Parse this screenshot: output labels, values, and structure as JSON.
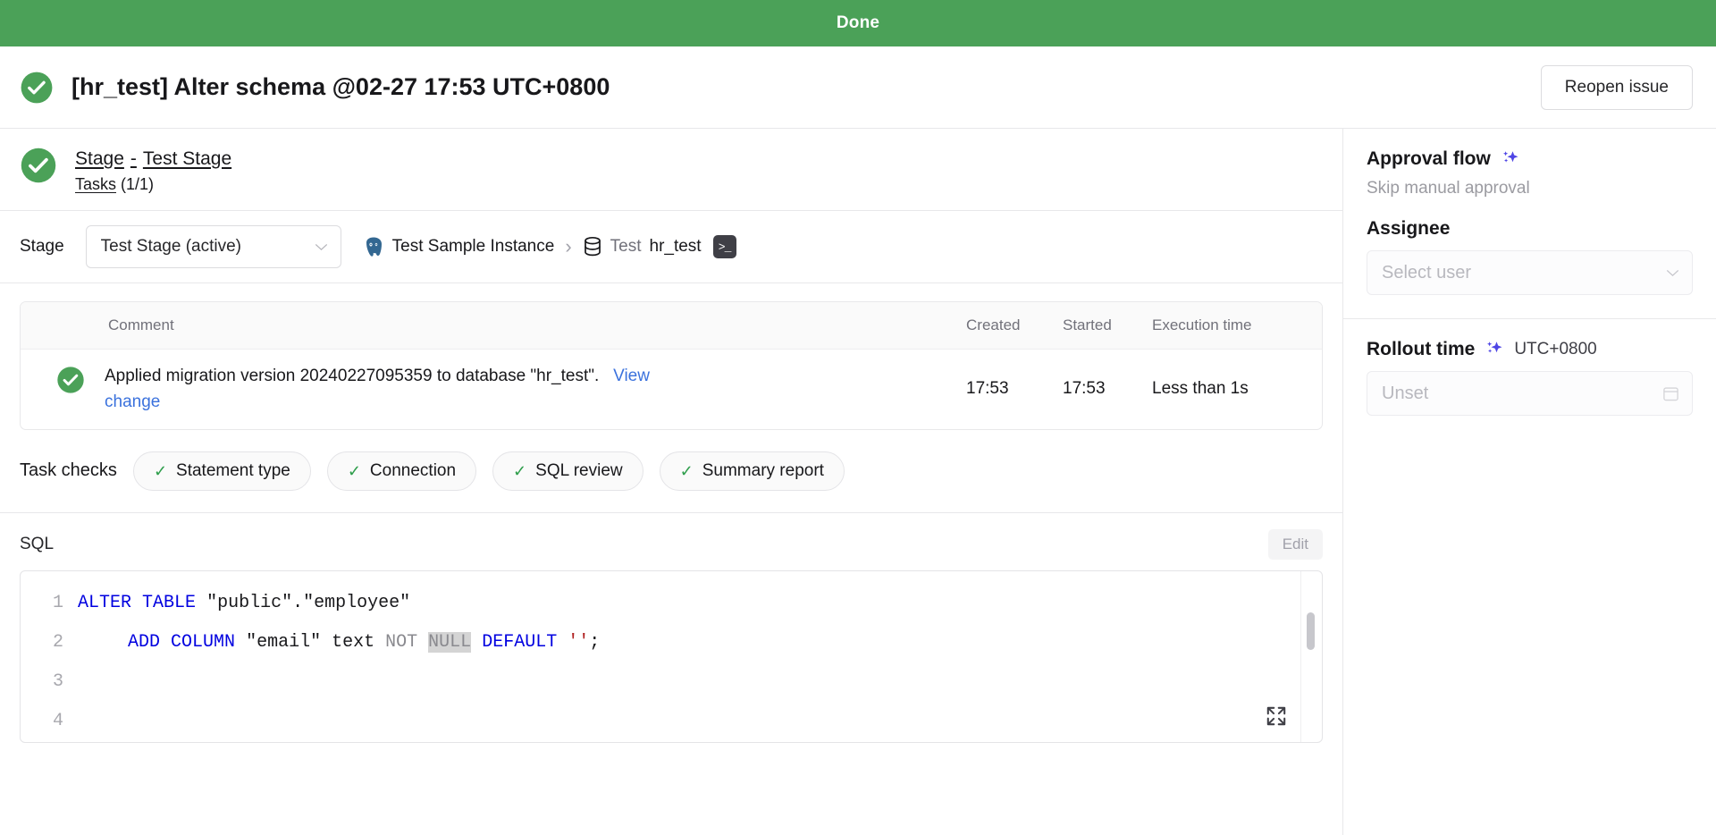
{
  "banner": {
    "status_text": "Done",
    "color": "#4ba158"
  },
  "header": {
    "title": "[hr_test] Alter schema @02-27 17:53 UTC+0800",
    "reopen_label": "Reopen issue",
    "status_icon": "check-circle-icon"
  },
  "stage_summary": {
    "stage_word": "Stage",
    "dash": "-",
    "stage_name": "Test Stage",
    "tasks_word": "Tasks",
    "tasks_count": "(1/1)"
  },
  "stage_row": {
    "label": "Stage",
    "selected": "Test Stage (active)",
    "breadcrumb": {
      "instance": "Test Sample Instance",
      "separator": "›",
      "environment": "Test",
      "database": "hr_test",
      "terminal_glyph": ">_"
    }
  },
  "task_table": {
    "columns": [
      "Comment",
      "Created",
      "Started",
      "Execution time"
    ],
    "rows": [
      {
        "status_icon": "check-circle-icon",
        "comment_text": "Applied migration version 20240227095359 to database \"hr_test\".",
        "comment_link": "View change",
        "created": "17:53",
        "started": "17:53",
        "execution_time": "Less than 1s"
      }
    ]
  },
  "task_checks": {
    "label": "Task checks",
    "tick": "✓",
    "items": [
      {
        "label": "Statement type"
      },
      {
        "label": "Connection"
      },
      {
        "label": "SQL review"
      },
      {
        "label": "Summary report"
      }
    ]
  },
  "sql": {
    "title": "SQL",
    "edit_label": "Edit",
    "line_numbers": [
      "1",
      "2",
      "3",
      "4"
    ],
    "lines": [
      {
        "n": "1",
        "tokens": [
          {
            "t": "ALTER",
            "c": "kw"
          },
          {
            "t": " ",
            "c": "punct"
          },
          {
            "t": "TABLE",
            "c": "kw"
          },
          {
            "t": " ",
            "c": "punct"
          },
          {
            "t": "\"public\".\"employee\"",
            "c": "str"
          }
        ]
      },
      {
        "n": "2",
        "indent": true,
        "tokens": [
          {
            "t": "ADD",
            "c": "kw"
          },
          {
            "t": " ",
            "c": "punct"
          },
          {
            "t": "COLUMN",
            "c": "kw"
          },
          {
            "t": " ",
            "c": "punct"
          },
          {
            "t": "\"email\"",
            "c": "str"
          },
          {
            "t": " ",
            "c": "punct"
          },
          {
            "t": "text",
            "c": "str"
          },
          {
            "t": " ",
            "c": "punct"
          },
          {
            "t": "NOT",
            "c": "kw-gray"
          },
          {
            "t": " ",
            "c": "punct"
          },
          {
            "t": "NULL",
            "c": "kw-gray-hl"
          },
          {
            "t": " ",
            "c": "punct"
          },
          {
            "t": "DEFAULT",
            "c": "kw"
          },
          {
            "t": " ",
            "c": "punct"
          },
          {
            "t": "''",
            "c": "lit"
          },
          {
            "t": ";",
            "c": "punct"
          }
        ]
      },
      {
        "n": "3",
        "tokens": []
      },
      {
        "n": "4",
        "tokens": []
      }
    ],
    "full_statement": "ALTER TABLE \"public\".\"employee\"\n    ADD COLUMN \"email\" text NOT NULL DEFAULT '';"
  },
  "sidebar": {
    "approval": {
      "title": "Approval flow",
      "sparkle_icon": "sparkles-icon",
      "value": "Skip manual approval"
    },
    "assignee": {
      "label": "Assignee",
      "placeholder": "Select user"
    },
    "rollout": {
      "title": "Rollout time",
      "sparkle_icon": "sparkles-icon",
      "timezone": "UTC+0800",
      "placeholder": "Unset",
      "calendar_icon": "calendar-icon"
    }
  },
  "colors": {
    "success_green": "#4ba158",
    "link_blue": "#3b72dd",
    "sparkle_purple": "#4f46e5",
    "keyword_blue": "#0000e0",
    "literal_red": "#b02020"
  }
}
